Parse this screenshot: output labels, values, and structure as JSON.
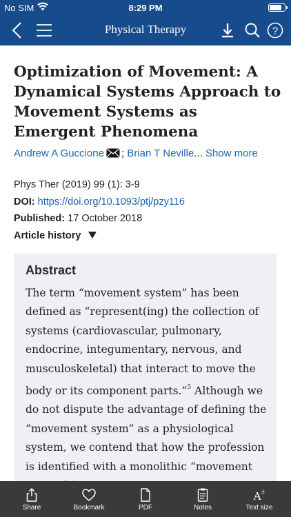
{
  "status_bar": {
    "carrier": "No SIM",
    "time": "8:29 PM",
    "battery_level": 0.85
  },
  "nav": {
    "title": "Physical Therapy",
    "icons": [
      "back-arrow-icon",
      "menu-icon",
      "download-icon",
      "search-icon",
      "help-icon"
    ]
  },
  "article": {
    "title": "Optimization of Movement: A Dynamical Systems Approach to Movement Systems as Emergent Phenomena",
    "author_1": "Andrew A Guccione",
    "author_separator": ";",
    "author_2": "Brian T Neville",
    "ellipsis": "...",
    "show_more": "Show more",
    "citation": "Phys Ther (2019) 99 (1): 3-9",
    "doi_label": "DOI:",
    "doi_value": "https://doi.org/10.1093/ptj/pzy116",
    "published_label": "Published:",
    "published_value": "17 October 2018",
    "history_label": "Article history"
  },
  "abstract": {
    "heading": "Abstract",
    "text_part1": "The term “movement system” has been defined as “represent(ing) the collection of systems (cardiovascular, pulmonary, endocrine, integumentary, nervous, and musculoskeletal) that interact to move the body or its component parts.”",
    "footnote": "5",
    "text_part2": " Although we do not dispute the advantage of defining the “movement system” as a physiological system, we contend that how the profession is identified with a monolithic “movement system” is"
  },
  "toolbar": {
    "share": "Share",
    "bookmark": "Bookmark",
    "pdf": "PDF",
    "notes": "Notes",
    "text_size": "Text size"
  },
  "colors": {
    "brand_blue": "#164b8c",
    "link_blue": "#1b65b0",
    "toolbar_bg": "#3a3a3a",
    "abstract_bg": "#eef0f4"
  }
}
